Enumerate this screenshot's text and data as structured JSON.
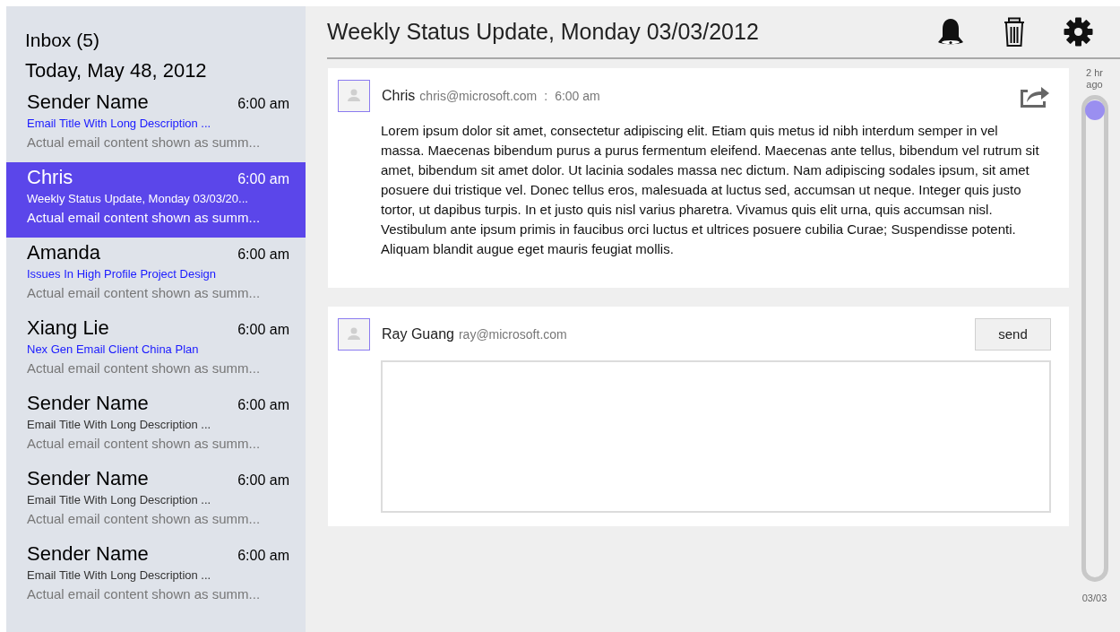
{
  "sidebar": {
    "title": "Inbox (5)",
    "date": "Today, May 48, 2012",
    "emails": [
      {
        "sender": "Sender Name",
        "time": "6:00 am",
        "subject": "Email Title With Long Description ...",
        "summary": "Actual email content shown as summ...",
        "unread": true,
        "selected": false
      },
      {
        "sender": "Chris",
        "time": "6:00 am",
        "subject": "Weekly Status Update, Monday 03/03/20...",
        "summary": "Actual email content shown as summ...",
        "selected": true
      },
      {
        "sender": "Amanda",
        "time": "6:00 am",
        "subject": "Issues In High Profile Project Design",
        "summary": "Actual email content shown as summ...",
        "unread": true,
        "selected": false
      },
      {
        "sender": "Xiang Lie",
        "time": "6:00 am",
        "subject": "Nex Gen Email Client China Plan",
        "summary": "Actual email content shown as summ...",
        "unread": true,
        "selected": false
      },
      {
        "sender": "Sender Name",
        "time": "6:00 am",
        "subject": "Email Title With Long Description ...",
        "summary": "Actual email content shown as summ...",
        "unread": false,
        "selected": false
      },
      {
        "sender": "Sender Name",
        "time": "6:00 am",
        "subject": "Email Title With Long Description ...",
        "summary": "Actual email content shown as summ...",
        "unread": false,
        "selected": false
      },
      {
        "sender": "Sender Name",
        "time": "6:00 am",
        "subject": "Email Title With Long Description ...",
        "summary": "Actual email content shown as summ...",
        "unread": false,
        "selected": false
      }
    ]
  },
  "thread": {
    "title": "Weekly Status Update, Monday 03/03/2012",
    "message": {
      "sender": "Chris",
      "email": "chris@microsoft.com",
      "separator": ":",
      "time": "6:00 am",
      "body": "Lorem ipsum dolor sit amet, consectetur adipiscing elit. Etiam quis metus id nibh interdum semper in vel massa. Maecenas bibendum purus a purus fermentum eleifend. Maecenas ante tellus, bibendum vel rutrum sit amet, bibendum sit amet dolor. Ut lacinia sodales massa nec dictum. Nam adipiscing sodales ipsum, sit amet posuere dui tristique vel. Donec tellus eros, malesuada at luctus sed, accumsan ut neque. Integer quis justo tortor, ut dapibus turpis. In et justo quis nisl varius pharetra. Vivamus quis elit urna, quis accumsan nisl. Vestibulum ante ipsum primis in faucibus orci luctus et ultrices posuere cubilia Curae; Suspendisse potenti. Aliquam blandit augue eget mauris feugiat mollis."
    },
    "reply": {
      "sender": "Ray Guang",
      "email": "ray@microsoft.com",
      "button": "send"
    }
  },
  "timeline": {
    "top_label": "2 hr ago",
    "bottom_label": "03/03",
    "level": 0
  }
}
